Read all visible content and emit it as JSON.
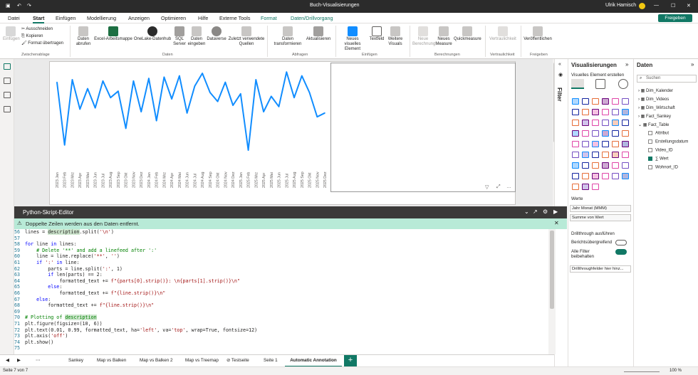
{
  "window": {
    "title": "Buch-Visualisierungen",
    "user": "Ulrik Hamisch"
  },
  "menu": {
    "items": [
      "Datei",
      "Start",
      "Einfügen",
      "Modellierung",
      "Anzeigen",
      "Optimieren",
      "Hilfe",
      "Externe Tools",
      "Format",
      "Daten/Drillvorgang"
    ],
    "share": "Freigeben"
  },
  "ribbon": {
    "paste": "Einfügen",
    "cut": "Ausschneiden",
    "copy": "Kopieren",
    "format_painter": "Format übertragen",
    "clipboard": "Zwischenablage",
    "get_data": "Daten abrufen",
    "excel": "Excel-Arbeitsmappe",
    "onelake": "OneLake-Datenhub",
    "sql": "SQL Server",
    "enter_data": "Daten eingeben",
    "dataverse": "Dataverse",
    "recent": "Zuletzt verwendete Quellen",
    "data_group": "Daten",
    "transform": "Daten transformieren",
    "refresh": "Aktualisieren",
    "queries_group": "Abfragen",
    "new_visual": "Neues visuelles Element",
    "textbox": "Textfeld",
    "more_visuals": "Weitere Visuals",
    "insert_group": "Einfügen",
    "new_calc": "Neue Berechnung",
    "new_measure": "Neues Measure",
    "quick_measure": "Quickmeasure",
    "calc_group": "Berechnungen",
    "sensitivity": "Vertraulichkeit",
    "sens_group": "Vertraulichkeit",
    "publish": "Veröffentlichen",
    "share_group": "Freigeben"
  },
  "chart_data": {
    "type": "line",
    "color": "#118DFF",
    "x": [
      "2023 Jan",
      "2023 Feb",
      "2023 Mrz",
      "2023 Apr",
      "2023 Mai",
      "2023 Jun",
      "2023 Jul",
      "2023 Aug",
      "2023 Sep",
      "2023 Okt",
      "2023 Nov",
      "2023 Dez",
      "2024 Jan",
      "2024 Feb",
      "2024 Mrz",
      "2024 Apr",
      "2024 Mai",
      "2024 Jun",
      "2024 Jul",
      "2024 Aug",
      "2024 Sep",
      "2024 Okt",
      "2024 Nov",
      "2024 Dez",
      "2025 Jan",
      "2025 Feb",
      "2025 Mrz",
      "2025 Apr",
      "2025 Mai",
      "2025 Jun",
      "2025 Jul",
      "2025 Aug",
      "2025 Sep",
      "2025 Okt",
      "2025 Nov",
      "2025 Dez"
    ],
    "y": [
      58,
      9,
      60,
      37,
      53,
      38,
      59,
      46,
      51,
      22,
      59,
      35,
      61,
      28,
      62,
      45,
      63,
      34,
      55,
      65,
      50,
      43,
      58,
      40,
      49,
      5,
      60,
      35,
      47,
      39,
      66,
      46,
      63,
      50,
      31,
      34
    ],
    "ylim": [
      0,
      70
    ],
    "grid": false
  },
  "editor": {
    "title": "Python-Skript-Editor",
    "warning": "Doppelte Zeilen werden aus den Daten entfernt.",
    "lines": [
      {
        "n": "56",
        "c": "lines = description.split('\\n')"
      },
      {
        "n": "57",
        "c": ""
      },
      {
        "n": "58",
        "c": "for line in lines:"
      },
      {
        "n": "59",
        "c": "    # Delete '**' and add a linefeed after ':'"
      },
      {
        "n": "60",
        "c": "    line = line.replace('**', '')"
      },
      {
        "n": "61",
        "c": "    if ':' in line:"
      },
      {
        "n": "62",
        "c": "        parts = line.split(':', 1)"
      },
      {
        "n": "63",
        "c": "        if len(parts) == 2:"
      },
      {
        "n": "64",
        "c": "            formatted_text += f\"{parts[0].strip()}: \\n{parts[1].strip()}\\n\""
      },
      {
        "n": "65",
        "c": "        else:"
      },
      {
        "n": "66",
        "c": "            formatted_text += f\"{line.strip()}\\n\""
      },
      {
        "n": "67",
        "c": "    else:"
      },
      {
        "n": "68",
        "c": "        formatted_text += f\"{line.strip()}\\n\""
      },
      {
        "n": "69",
        "c": ""
      },
      {
        "n": "70",
        "c": "# Plotting of description"
      },
      {
        "n": "71",
        "c": "plt.figure(figsize=(10, 6))"
      },
      {
        "n": "72",
        "c": "plt.text(0.01, 0.99, formatted_text, ha='left', va='top', wrap=True, fontsize=12)"
      },
      {
        "n": "73",
        "c": "plt.axis('off')"
      },
      {
        "n": "74",
        "c": "plt.show()"
      },
      {
        "n": "75",
        "c": ""
      }
    ]
  },
  "tabs": {
    "items": [
      "Sankey",
      "Map vs Balken",
      "Map vs Balken 2",
      "Map vs Treemap",
      "Testseite",
      "Seite 1",
      "Automatic Annotation"
    ],
    "active": "Automatic Annotation",
    "add": "+"
  },
  "status": {
    "page": "Seite 7 von 7",
    "zoom": "100 %"
  },
  "filter_label": "Filter",
  "vis_pane": {
    "title": "Visualisierungen",
    "build": "Visuelles Element erstellen",
    "values_label": "Werte",
    "fields": [
      "Jahr Monat (MMM)",
      "Summe von Wert"
    ],
    "drill_title": "Drillthrough ausführen",
    "cross_report": "Berichtsübergreifend",
    "keep_filters": "Alle Filter beibehalten",
    "drill_placeholder": "Drillthroughfelder hier hinz..."
  },
  "data_pane": {
    "title": "Daten",
    "search": "Suchen",
    "tables": [
      "Dim_Kalender",
      "Dim_Videos",
      "Dim_Wirtschaft",
      "Fact_Sankey",
      "Fact_Table"
    ],
    "fields": [
      {
        "name": "Attribut",
        "checked": false
      },
      {
        "name": "Erstellungsdatum",
        "checked": false
      },
      {
        "name": "Video_ID",
        "checked": false
      },
      {
        "name": "∑ Wert",
        "checked": true
      },
      {
        "name": "Wohnort_ID",
        "checked": false
      }
    ]
  }
}
